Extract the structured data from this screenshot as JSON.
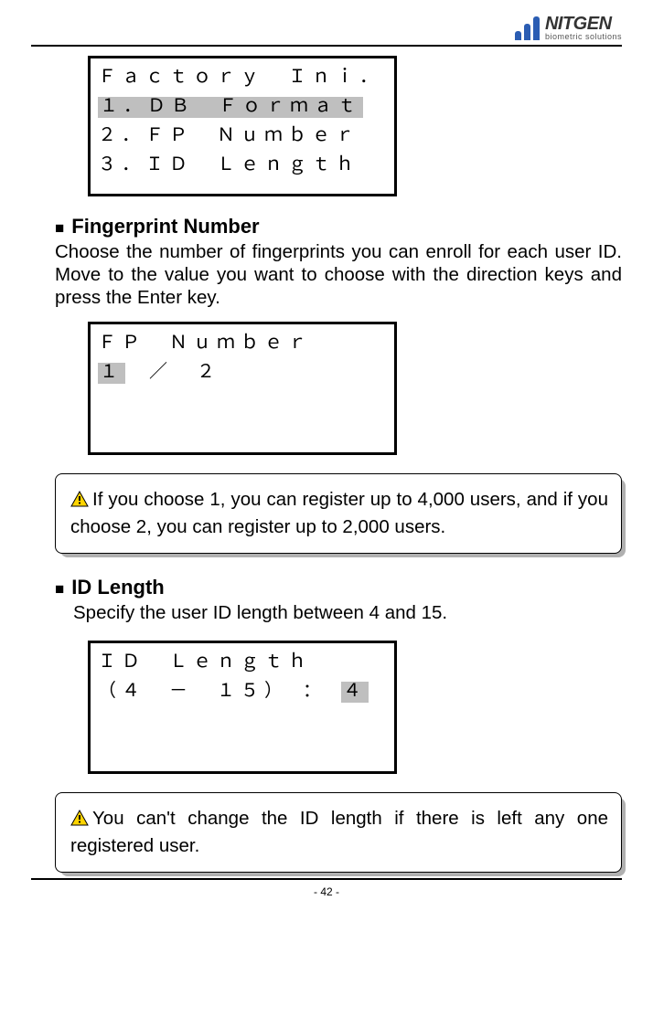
{
  "brand": {
    "name": "NITGEN",
    "tagline": "biometric solutions"
  },
  "lcd1": {
    "title": "Ｆａｃｔｏｒｙ　Ｉｎｉ．",
    "item1": "１．ＤＢ　Ｆｏｒｍａｔ",
    "item2": "２．ＦＰ　Ｎｕｍｂｅｒ",
    "item3": "３．ＩＤ　Ｌｅｎｇｔｈ"
  },
  "section1": {
    "title": "Fingerprint Number",
    "desc": "Choose the number of fingerprints you can enroll for each user ID. Move to the value you want to choose with the direction keys and press the Enter key."
  },
  "lcd2": {
    "title": "ＦＰ　Ｎｕｍｂｅｒ",
    "sel": "１",
    "rest": "　／　２"
  },
  "note1": "If you choose 1, you can register up to 4,000 users, and if you choose 2, you can register up to 2,000 users.",
  "section2": {
    "title": "ID Length",
    "desc": "Specify the user ID length between 4 and 15."
  },
  "lcd3": {
    "title": "ＩＤ　Ｌｅｎｇｔｈ",
    "prefix": "（４　－　１５）　：　",
    "value": "４"
  },
  "note2": "You can't change the ID length if there is left any one registered user.",
  "page_number": "- 42 -"
}
